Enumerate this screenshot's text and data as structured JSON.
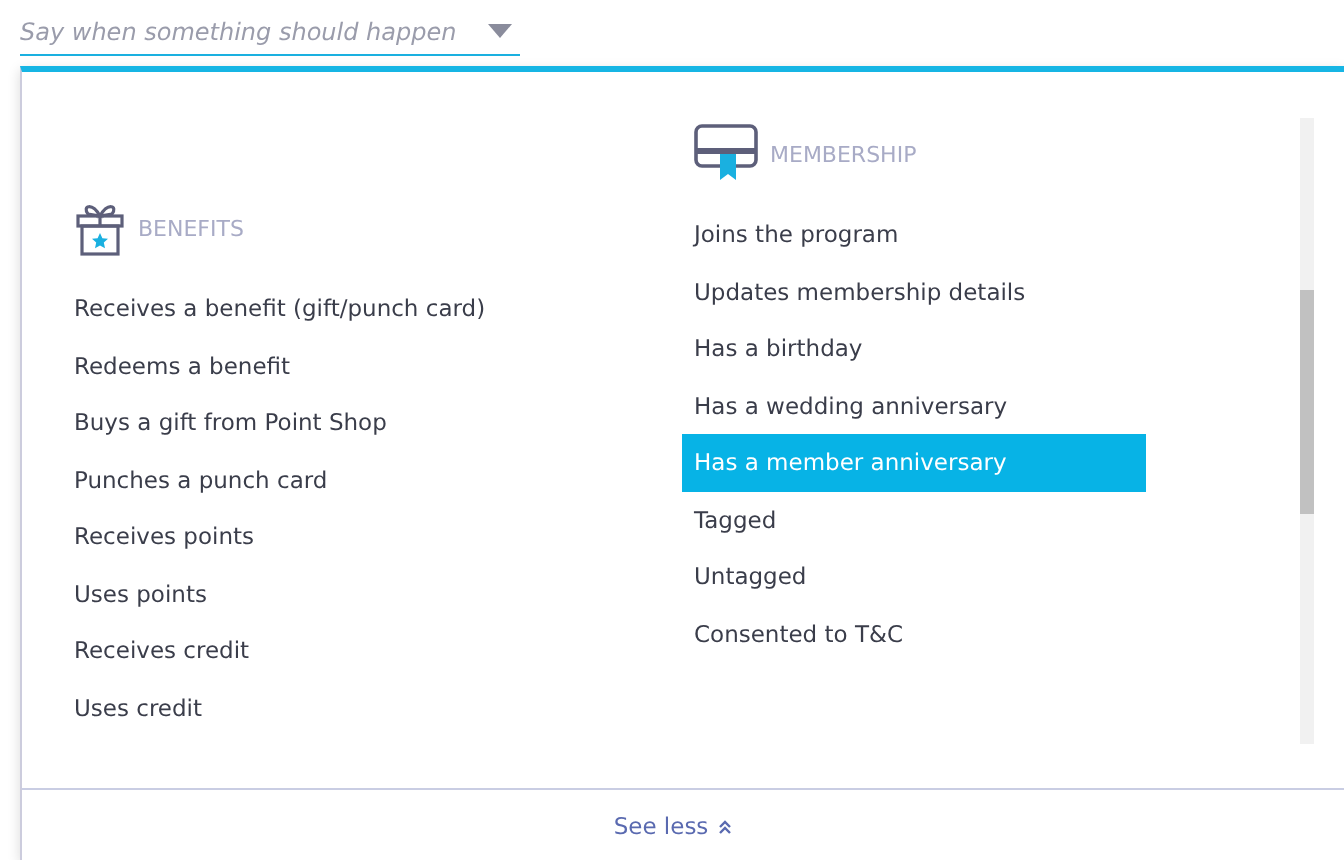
{
  "trigger_field": {
    "placeholder": "Say when something should happen"
  },
  "groups": [
    {
      "kind": "benefits",
      "title": "BENEFITS",
      "items": [
        {
          "label": "Receives a benefit (gift/punch card)",
          "selected": false
        },
        {
          "label": "Redeems a benefit",
          "selected": false
        },
        {
          "label": "Buys a gift from Point Shop",
          "selected": false
        },
        {
          "label": "Punches a punch card",
          "selected": false
        },
        {
          "label": "Receives points",
          "selected": false
        },
        {
          "label": "Uses points",
          "selected": false
        },
        {
          "label": "Receives credit",
          "selected": false
        },
        {
          "label": "Uses credit",
          "selected": false
        }
      ]
    },
    {
      "kind": "membership",
      "title": "MEMBERSHIP",
      "items": [
        {
          "label": "Joins the program",
          "selected": false
        },
        {
          "label": "Updates membership details",
          "selected": false
        },
        {
          "label": "Has a birthday",
          "selected": false
        },
        {
          "label": "Has a wedding anniversary",
          "selected": false
        },
        {
          "label": "Has a member anniversary",
          "selected": true
        },
        {
          "label": "Tagged",
          "selected": false
        },
        {
          "label": "Untagged",
          "selected": false
        },
        {
          "label": "Consented to T&C",
          "selected": false
        }
      ]
    }
  ],
  "footer": {
    "label": "See less"
  }
}
